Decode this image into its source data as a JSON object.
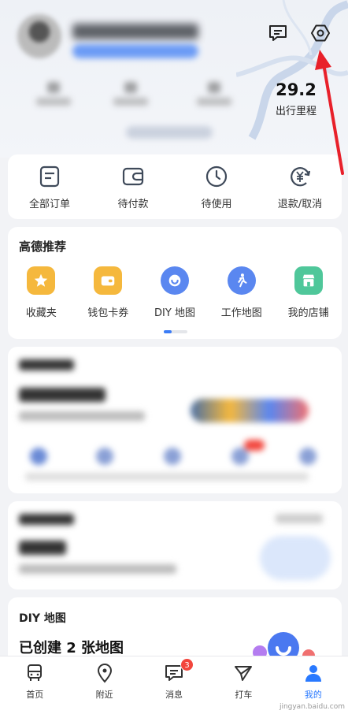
{
  "header": {
    "mileage_value": "29.2",
    "mileage_label": "出行里程"
  },
  "orders": [
    {
      "label": "全部订单",
      "icon": "order-list-icon"
    },
    {
      "label": "待付款",
      "icon": "wallet-icon"
    },
    {
      "label": "待使用",
      "icon": "clock-icon"
    },
    {
      "label": "退款/取消",
      "icon": "refund-icon"
    }
  ],
  "recommend": {
    "title": "高德推荐",
    "items": [
      {
        "label": "收藏夹",
        "icon": "star-icon",
        "color": "#f5b83d"
      },
      {
        "label": "钱包卡券",
        "icon": "wallet-card-icon",
        "color": "#f5b83d"
      },
      {
        "label": "DIY 地图",
        "icon": "diy-map-icon",
        "color": "#5a87f0"
      },
      {
        "label": "工作地图",
        "icon": "walking-person-icon",
        "color": "#5a87f0"
      },
      {
        "label": "我的店铺",
        "icon": "shop-icon",
        "color": "#4fc79a"
      }
    ]
  },
  "diy": {
    "title": "DIY 地图",
    "subtitle": "已创建 2 张地图"
  },
  "tabbar": [
    {
      "label": "首页",
      "icon": "bus-icon"
    },
    {
      "label": "附近",
      "icon": "location-pin-icon"
    },
    {
      "label": "消息",
      "icon": "message-icon",
      "badge": "3"
    },
    {
      "label": "打车",
      "icon": "taxi-icon"
    },
    {
      "label": "我的",
      "icon": "person-icon",
      "active": true
    }
  ],
  "watermark": "jingyan.baidu.com",
  "colors": {
    "accent": "#2979ff",
    "badge": "#f2463d",
    "annotation_arrow": "#e8202a"
  }
}
